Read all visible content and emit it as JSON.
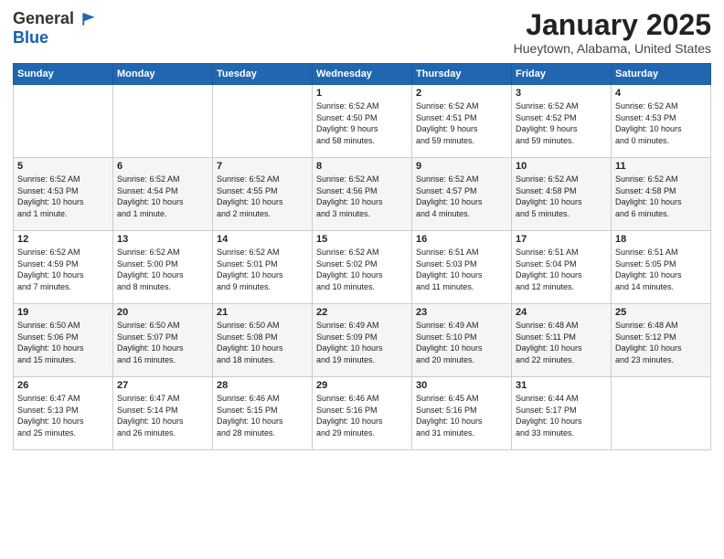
{
  "header": {
    "logo_line1": "General",
    "logo_line2": "Blue",
    "title": "January 2025",
    "subtitle": "Hueytown, Alabama, United States"
  },
  "weekdays": [
    "Sunday",
    "Monday",
    "Tuesday",
    "Wednesday",
    "Thursday",
    "Friday",
    "Saturday"
  ],
  "weeks": [
    [
      {
        "day": "",
        "info": ""
      },
      {
        "day": "",
        "info": ""
      },
      {
        "day": "",
        "info": ""
      },
      {
        "day": "1",
        "info": "Sunrise: 6:52 AM\nSunset: 4:50 PM\nDaylight: 9 hours\nand 58 minutes."
      },
      {
        "day": "2",
        "info": "Sunrise: 6:52 AM\nSunset: 4:51 PM\nDaylight: 9 hours\nand 59 minutes."
      },
      {
        "day": "3",
        "info": "Sunrise: 6:52 AM\nSunset: 4:52 PM\nDaylight: 9 hours\nand 59 minutes."
      },
      {
        "day": "4",
        "info": "Sunrise: 6:52 AM\nSunset: 4:53 PM\nDaylight: 10 hours\nand 0 minutes."
      }
    ],
    [
      {
        "day": "5",
        "info": "Sunrise: 6:52 AM\nSunset: 4:53 PM\nDaylight: 10 hours\nand 1 minute."
      },
      {
        "day": "6",
        "info": "Sunrise: 6:52 AM\nSunset: 4:54 PM\nDaylight: 10 hours\nand 1 minute."
      },
      {
        "day": "7",
        "info": "Sunrise: 6:52 AM\nSunset: 4:55 PM\nDaylight: 10 hours\nand 2 minutes."
      },
      {
        "day": "8",
        "info": "Sunrise: 6:52 AM\nSunset: 4:56 PM\nDaylight: 10 hours\nand 3 minutes."
      },
      {
        "day": "9",
        "info": "Sunrise: 6:52 AM\nSunset: 4:57 PM\nDaylight: 10 hours\nand 4 minutes."
      },
      {
        "day": "10",
        "info": "Sunrise: 6:52 AM\nSunset: 4:58 PM\nDaylight: 10 hours\nand 5 minutes."
      },
      {
        "day": "11",
        "info": "Sunrise: 6:52 AM\nSunset: 4:58 PM\nDaylight: 10 hours\nand 6 minutes."
      }
    ],
    [
      {
        "day": "12",
        "info": "Sunrise: 6:52 AM\nSunset: 4:59 PM\nDaylight: 10 hours\nand 7 minutes."
      },
      {
        "day": "13",
        "info": "Sunrise: 6:52 AM\nSunset: 5:00 PM\nDaylight: 10 hours\nand 8 minutes."
      },
      {
        "day": "14",
        "info": "Sunrise: 6:52 AM\nSunset: 5:01 PM\nDaylight: 10 hours\nand 9 minutes."
      },
      {
        "day": "15",
        "info": "Sunrise: 6:52 AM\nSunset: 5:02 PM\nDaylight: 10 hours\nand 10 minutes."
      },
      {
        "day": "16",
        "info": "Sunrise: 6:51 AM\nSunset: 5:03 PM\nDaylight: 10 hours\nand 11 minutes."
      },
      {
        "day": "17",
        "info": "Sunrise: 6:51 AM\nSunset: 5:04 PM\nDaylight: 10 hours\nand 12 minutes."
      },
      {
        "day": "18",
        "info": "Sunrise: 6:51 AM\nSunset: 5:05 PM\nDaylight: 10 hours\nand 14 minutes."
      }
    ],
    [
      {
        "day": "19",
        "info": "Sunrise: 6:50 AM\nSunset: 5:06 PM\nDaylight: 10 hours\nand 15 minutes."
      },
      {
        "day": "20",
        "info": "Sunrise: 6:50 AM\nSunset: 5:07 PM\nDaylight: 10 hours\nand 16 minutes."
      },
      {
        "day": "21",
        "info": "Sunrise: 6:50 AM\nSunset: 5:08 PM\nDaylight: 10 hours\nand 18 minutes."
      },
      {
        "day": "22",
        "info": "Sunrise: 6:49 AM\nSunset: 5:09 PM\nDaylight: 10 hours\nand 19 minutes."
      },
      {
        "day": "23",
        "info": "Sunrise: 6:49 AM\nSunset: 5:10 PM\nDaylight: 10 hours\nand 20 minutes."
      },
      {
        "day": "24",
        "info": "Sunrise: 6:48 AM\nSunset: 5:11 PM\nDaylight: 10 hours\nand 22 minutes."
      },
      {
        "day": "25",
        "info": "Sunrise: 6:48 AM\nSunset: 5:12 PM\nDaylight: 10 hours\nand 23 minutes."
      }
    ],
    [
      {
        "day": "26",
        "info": "Sunrise: 6:47 AM\nSunset: 5:13 PM\nDaylight: 10 hours\nand 25 minutes."
      },
      {
        "day": "27",
        "info": "Sunrise: 6:47 AM\nSunset: 5:14 PM\nDaylight: 10 hours\nand 26 minutes."
      },
      {
        "day": "28",
        "info": "Sunrise: 6:46 AM\nSunset: 5:15 PM\nDaylight: 10 hours\nand 28 minutes."
      },
      {
        "day": "29",
        "info": "Sunrise: 6:46 AM\nSunset: 5:16 PM\nDaylight: 10 hours\nand 29 minutes."
      },
      {
        "day": "30",
        "info": "Sunrise: 6:45 AM\nSunset: 5:16 PM\nDaylight: 10 hours\nand 31 minutes."
      },
      {
        "day": "31",
        "info": "Sunrise: 6:44 AM\nSunset: 5:17 PM\nDaylight: 10 hours\nand 33 minutes."
      },
      {
        "day": "",
        "info": ""
      }
    ]
  ]
}
